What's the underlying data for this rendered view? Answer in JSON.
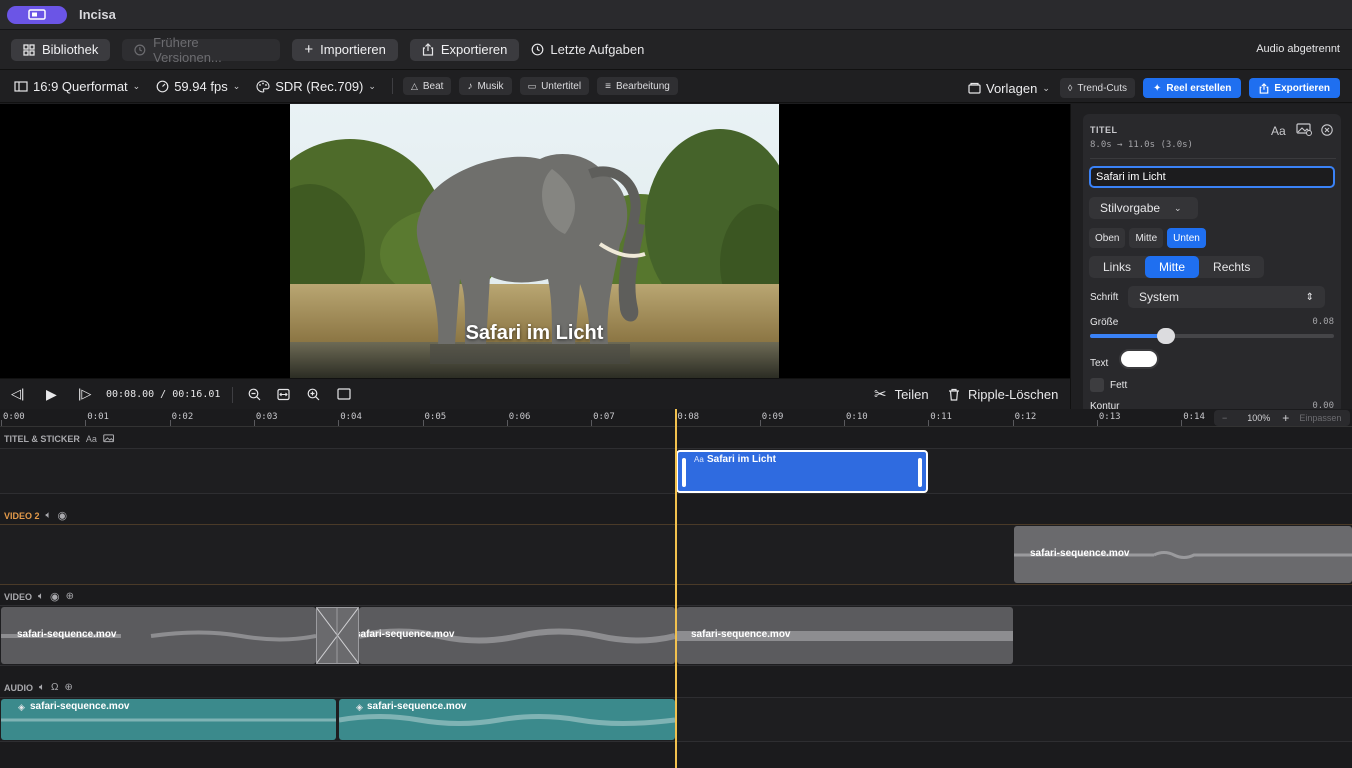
{
  "app": {
    "name": "Incisa"
  },
  "toolbar": {
    "library": "Bibliothek",
    "versions": "Frühere Versionen...",
    "import": "Importieren",
    "export": "Exportieren",
    "recent": "Letzte Aufgaben",
    "status": "Audio abgetrennt"
  },
  "format_bar": {
    "aspect": "16:9 Querformat",
    "fps": "59.94 fps",
    "color": "SDR (Rec.709)",
    "chips": [
      "Beat",
      "Musik",
      "Untertitel",
      "Bearbeitung"
    ],
    "templates": "Vorlagen",
    "trend": "Trend-Cuts",
    "reel": "Reel erstellen",
    "export": "Exportieren"
  },
  "preview": {
    "caption": "Safari im Licht"
  },
  "inspector": {
    "section": "TITEL",
    "timing": "8.0s → 11.0s  (3.0s)",
    "aa_glyph": "Aa",
    "title_value": "Safari im Licht",
    "style_preset": "Stilvorgabe",
    "vertical": [
      "Oben",
      "Mitte",
      "Unten"
    ],
    "vertical_active": 2,
    "horizontal": [
      "Links",
      "Mitte",
      "Rechts"
    ],
    "horizontal_active": 1,
    "font_label": "Schrift",
    "font_value": "System",
    "size_label": "Größe",
    "size_value": "0.08",
    "size_fraction": 0.31,
    "text_label": "Text",
    "bold_label": "Fett",
    "outline_label": "Kontur",
    "outline_value": "0.00"
  },
  "transport": {
    "timecode": "00:08.00 / 00:16.01",
    "split": "Teilen",
    "ripple": "Ripple-Löschen"
  },
  "ruler": {
    "ticks": [
      "0:00",
      "0:01",
      "0:02",
      "0:03",
      "0:04",
      "0:05",
      "0:06",
      "0:07",
      "0:08",
      "0:09",
      "0:10",
      "0:11",
      "0:12",
      "0:13",
      "0:14"
    ],
    "zoom": "100%",
    "fit": "Einpassen"
  },
  "tracks": {
    "titles": {
      "name": "TITEL & STICKER",
      "aa": "Aa",
      "clip": "Safari im Licht",
      "clip_aa": "Aa"
    },
    "video2": {
      "name": "VIDEO 2",
      "clip": "safari-sequence.mov"
    },
    "video": {
      "name": "VIDEO",
      "clips": [
        "safari-sequence.mov",
        "safari-sequence.mov",
        "safari-sequence.mov"
      ]
    },
    "audio": {
      "name": "AUDIO",
      "clips": [
        "safari-sequence.mov",
        "safari-sequence.mov"
      ]
    }
  },
  "colors": {
    "accent": "#1f6ff0",
    "app_pill": "#6b55e6",
    "playhead": "#f2c14e",
    "audio_clip": "#3b8a8c",
    "video_clip": "#5b5b5e",
    "video2_label": "#e39a4a"
  }
}
